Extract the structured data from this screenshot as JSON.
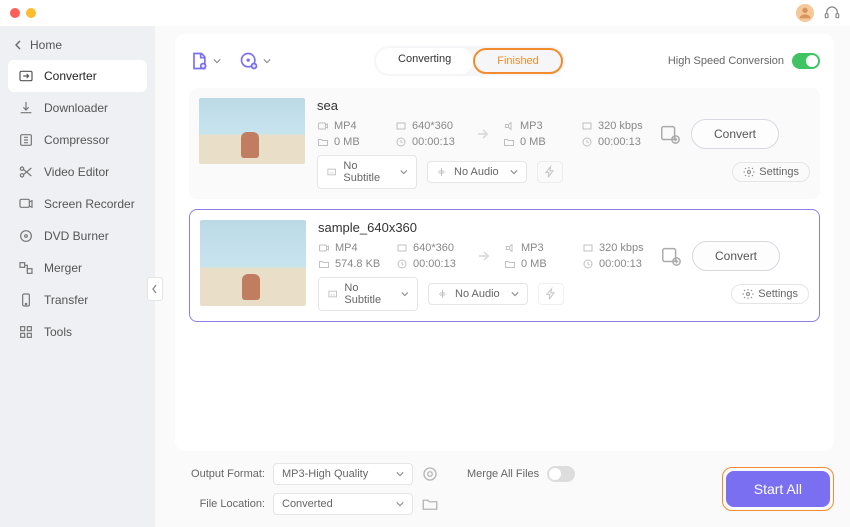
{
  "home_label": "Home",
  "sidebar": {
    "items": [
      {
        "label": "Converter"
      },
      {
        "label": "Downloader"
      },
      {
        "label": "Compressor"
      },
      {
        "label": "Video Editor"
      },
      {
        "label": "Screen Recorder"
      },
      {
        "label": "DVD Burner"
      },
      {
        "label": "Merger"
      },
      {
        "label": "Transfer"
      },
      {
        "label": "Tools"
      }
    ]
  },
  "tabs": {
    "converting": "Converting",
    "finished": "Finished"
  },
  "high_speed_label": "High Speed Conversion",
  "items": [
    {
      "title": "sea",
      "src_format": "MP4",
      "src_res": "640*360",
      "src_size": "0 MB",
      "src_dur": "00:00:13",
      "dst_format": "MP3",
      "dst_size": "0 MB",
      "dst_rate": "320 kbps",
      "dst_dur": "00:00:13",
      "subtitle": "No Subtitle",
      "audio": "No Audio",
      "settings": "Settings",
      "convert": "Convert"
    },
    {
      "title": "sample_640x360",
      "src_format": "MP4",
      "src_res": "640*360",
      "src_size": "574.8 KB",
      "src_dur": "00:00:13",
      "dst_format": "MP3",
      "dst_size": "0 MB",
      "dst_rate": "320 kbps",
      "dst_dur": "00:00:13",
      "subtitle": "No Subtitle",
      "audio": "No Audio",
      "settings": "Settings",
      "convert": "Convert"
    }
  ],
  "footer": {
    "output_format_label": "Output Format:",
    "output_format_value": "MP3-High Quality",
    "file_location_label": "File Location:",
    "file_location_value": "Converted",
    "merge_label": "Merge All Files",
    "start_all": "Start All"
  }
}
